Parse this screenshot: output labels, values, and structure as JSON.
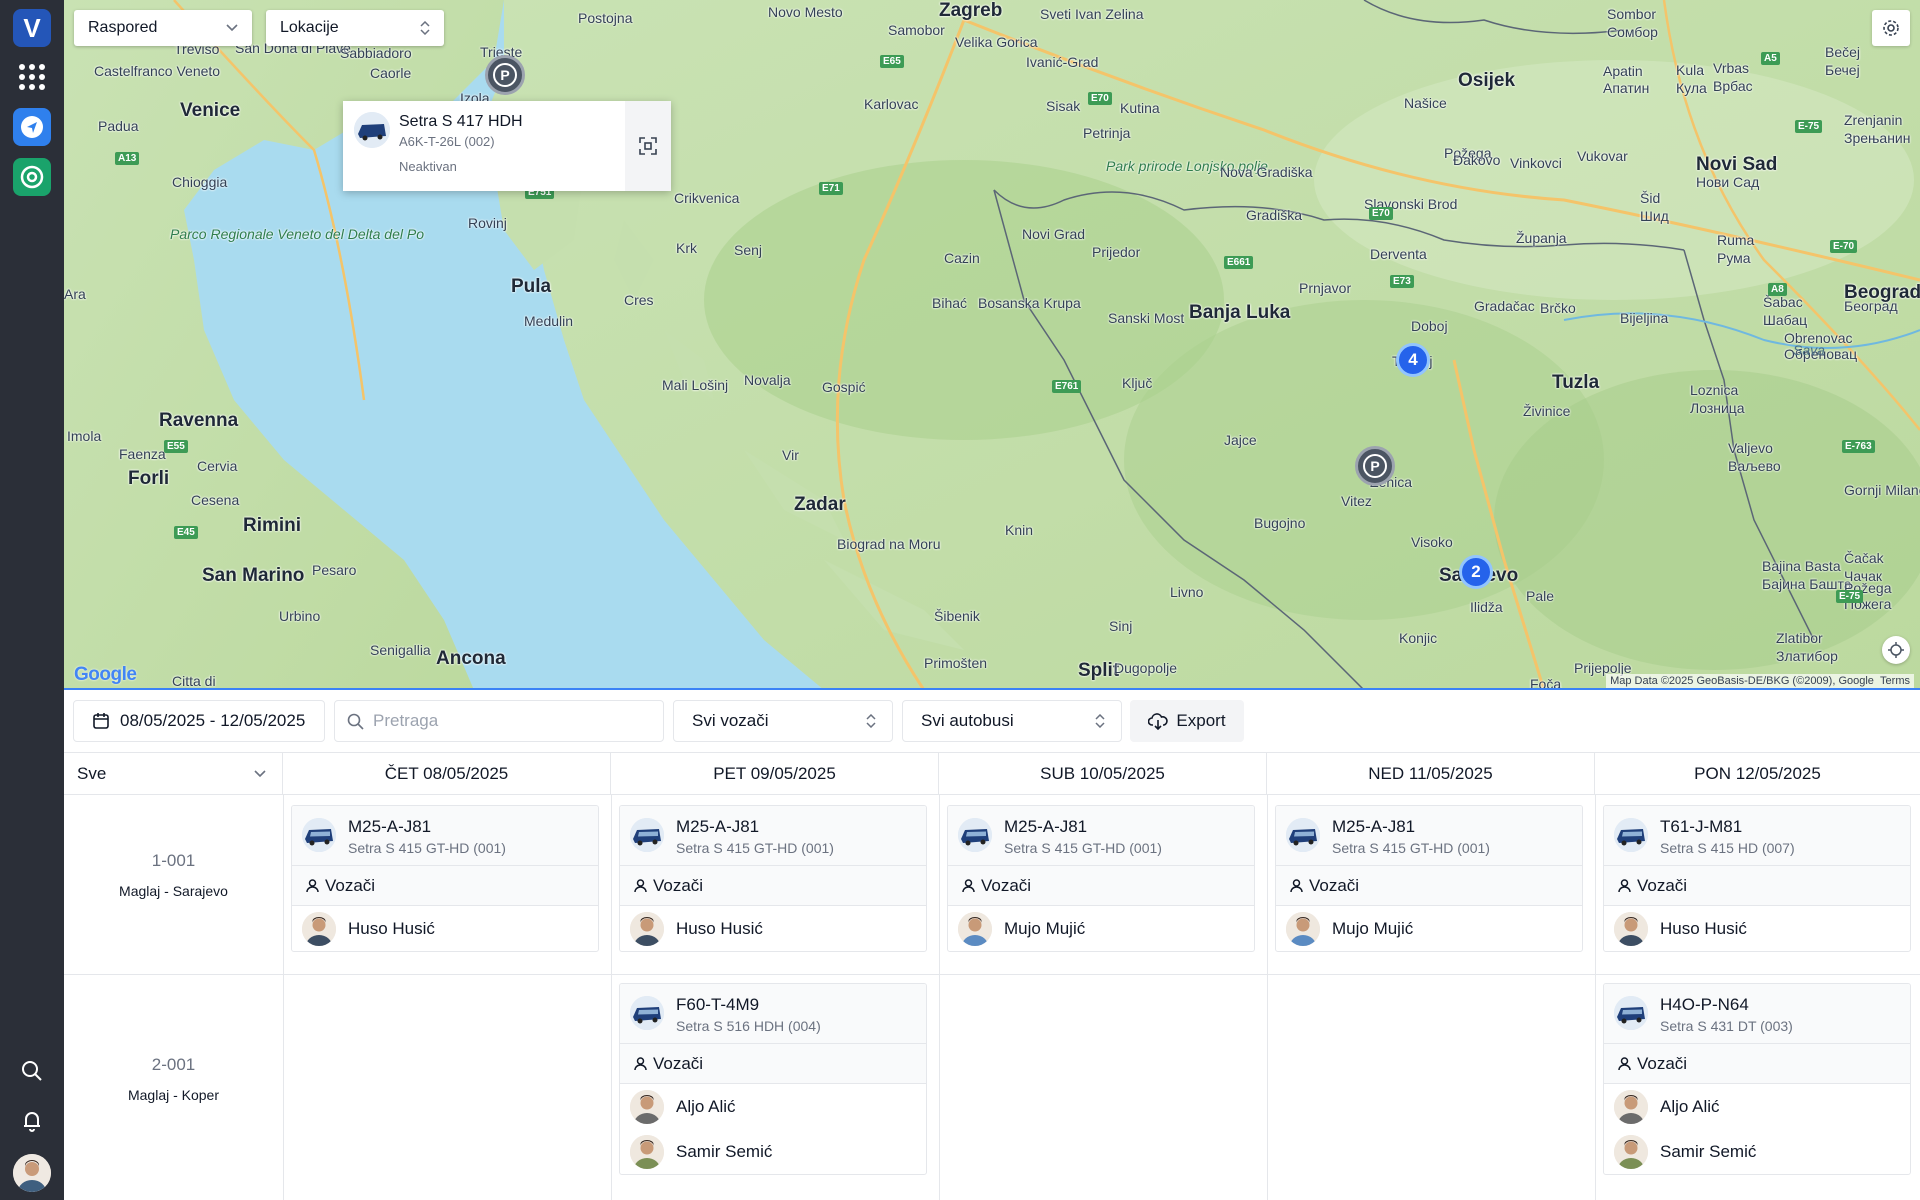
{
  "sidebar": {
    "logo_letter": "V",
    "icons": [
      "apps-grid-icon",
      "navigation-icon",
      "tracking-icon",
      "search-icon",
      "bell-icon"
    ]
  },
  "map": {
    "layer_select": "Raspored",
    "locations_select": "Lokacije",
    "popup": {
      "name": "Setra S 417 HDH",
      "plate": "A6K-T-26L (002)",
      "status": "Neaktivan"
    },
    "clusters": [
      "4",
      "2"
    ],
    "parking_symbol": "P",
    "attribution": "Map Data ©2025 GeoBasis-DE/BKG (©2009), Google",
    "terms": "Terms",
    "google": "Google",
    "labels": [
      {
        "t": "Venice",
        "c": "big"
      },
      {
        "t": "Trieste",
        "c": ""
      },
      {
        "t": "Padua",
        "c": ""
      },
      {
        "t": "Treviso",
        "c": ""
      },
      {
        "t": "Castelfranco Veneto",
        "c": ""
      },
      {
        "t": "San Dona di Piave",
        "c": ""
      },
      {
        "t": "Sabbiadoro",
        "c": ""
      },
      {
        "t": "Caorle",
        "c": ""
      },
      {
        "t": "Postojna",
        "c": ""
      },
      {
        "t": "Novo Mesto",
        "c": ""
      },
      {
        "t": "Zagreb",
        "c": "big"
      },
      {
        "t": "Samobor",
        "c": ""
      },
      {
        "t": "Velika Gorica",
        "c": ""
      },
      {
        "t": "Sveti Ivan Zelina",
        "c": ""
      },
      {
        "t": "Ivanić-Grad",
        "c": ""
      },
      {
        "t": "Karlovac",
        "c": ""
      },
      {
        "t": "Sisak",
        "c": ""
      },
      {
        "t": "Kutina",
        "c": ""
      },
      {
        "t": "Petrinja",
        "c": ""
      },
      {
        "t": "Park prirode Lonjsko polje",
        "c": "green"
      },
      {
        "t": "Našice",
        "c": ""
      },
      {
        "t": "Osijek",
        "c": "big"
      },
      {
        "t": "Požega",
        "c": ""
      },
      {
        "t": "Đakovo",
        "c": ""
      },
      {
        "t": "Vinkovci",
        "c": ""
      },
      {
        "t": "Vukovar",
        "c": ""
      },
      {
        "t": "Nova Gradiška",
        "c": ""
      },
      {
        "t": "Slavonski Brod",
        "c": ""
      },
      {
        "t": "Gradiška",
        "c": ""
      },
      {
        "t": "Novi Grad",
        "c": ""
      },
      {
        "t": "Prijedor",
        "c": ""
      },
      {
        "t": "Derventa",
        "c": ""
      },
      {
        "t": "Županja",
        "c": ""
      },
      {
        "t": "Cazin",
        "c": ""
      },
      {
        "t": "Bihać",
        "c": ""
      },
      {
        "t": "Bosanska Krupa",
        "c": ""
      },
      {
        "t": "Sanski Most",
        "c": ""
      },
      {
        "t": "Banja Luka",
        "c": "big"
      },
      {
        "t": "Prnjavor",
        "c": ""
      },
      {
        "t": "Doboj",
        "c": ""
      },
      {
        "t": "Gradačac",
        "c": ""
      },
      {
        "t": "Brčko",
        "c": ""
      },
      {
        "t": "Bijeljina",
        "c": ""
      },
      {
        "t": "Tuzla",
        "c": "big"
      },
      {
        "t": "Živinice",
        "c": ""
      },
      {
        "t": "Tešanj",
        "c": ""
      },
      {
        "t": "Ključ",
        "c": ""
      },
      {
        "t": "Jajce",
        "c": ""
      },
      {
        "t": "Vitez",
        "c": ""
      },
      {
        "t": "Zenica",
        "c": ""
      },
      {
        "t": "Bugojno",
        "c": ""
      },
      {
        "t": "Visoko",
        "c": ""
      },
      {
        "t": "Sarajevo",
        "c": "big"
      },
      {
        "t": "Pale",
        "c": ""
      },
      {
        "t": "Ilidža",
        "c": ""
      },
      {
        "t": "Konjic",
        "c": ""
      },
      {
        "t": "Livno",
        "c": ""
      },
      {
        "t": "Knin",
        "c": ""
      },
      {
        "t": "Sinj",
        "c": ""
      },
      {
        "t": "Split",
        "c": "big"
      },
      {
        "t": "Dugopolje",
        "c": ""
      },
      {
        "t": "Šibenik",
        "c": ""
      },
      {
        "t": "Primošten",
        "c": ""
      },
      {
        "t": "Zadar",
        "c": "big"
      },
      {
        "t": "Biograd na Moru",
        "c": ""
      },
      {
        "t": "Vir",
        "c": ""
      },
      {
        "t": "Gospić",
        "c": ""
      },
      {
        "t": "Novalja",
        "c": ""
      },
      {
        "t": "Mali Lošinj",
        "c": ""
      },
      {
        "t": "Cres",
        "c": ""
      },
      {
        "t": "Krk",
        "c": ""
      },
      {
        "t": "Senj",
        "c": ""
      },
      {
        "t": "Crikvenica",
        "c": ""
      },
      {
        "t": "Rovinj",
        "c": ""
      },
      {
        "t": "Pula",
        "c": "big"
      },
      {
        "t": "Medulin",
        "c": ""
      },
      {
        "t": "Chioggia",
        "c": ""
      },
      {
        "t": "Parco Regionale Veneto del Delta del Po",
        "c": "green"
      },
      {
        "t": "Ravenna",
        "c": "big"
      },
      {
        "t": "Faenza",
        "c": ""
      },
      {
        "t": "Forli",
        "c": "big"
      },
      {
        "t": "Cervia",
        "c": ""
      },
      {
        "t": "Cesena",
        "c": ""
      },
      {
        "t": "Rimini",
        "c": "big"
      },
      {
        "t": "San Marino",
        "c": "big"
      },
      {
        "t": "Pesaro",
        "c": ""
      },
      {
        "t": "Urbino",
        "c": ""
      },
      {
        "t": "Senigallia",
        "c": ""
      },
      {
        "t": "Ancona",
        "c": "big"
      },
      {
        "t": "Citta di",
        "c": ""
      },
      {
        "t": "Imola",
        "c": ""
      },
      {
        "t": "Novi Sad",
        "c": "big"
      },
      {
        "t": "Нови Сад",
        "c": ""
      },
      {
        "t": "Sombor",
        "c": ""
      },
      {
        "t": "Сомбор",
        "c": ""
      },
      {
        "t": "Vrbas",
        "c": ""
      },
      {
        "t": "Врбас",
        "c": ""
      },
      {
        "t": "Bečej",
        "c": ""
      },
      {
        "t": "Бечеј",
        "c": ""
      },
      {
        "t": "Zrenjanin",
        "c": ""
      },
      {
        "t": "Зрењанин",
        "c": ""
      },
      {
        "t": "Apatin",
        "c": ""
      },
      {
        "t": "Апатин",
        "c": ""
      },
      {
        "t": "Kula",
        "c": ""
      },
      {
        "t": "Кула",
        "c": ""
      },
      {
        "t": "Šid",
        "c": ""
      },
      {
        "t": "Шид",
        "c": ""
      },
      {
        "t": "Ruma",
        "c": ""
      },
      {
        "t": "Рума",
        "c": ""
      },
      {
        "t": "Šabac",
        "c": ""
      },
      {
        "t": "Шабац",
        "c": ""
      },
      {
        "t": "Obrenovac",
        "c": ""
      },
      {
        "t": "Обреновац",
        "c": ""
      },
      {
        "t": "Sava",
        "c": "sea"
      },
      {
        "t": "Beograd",
        "c": "big"
      },
      {
        "t": "Београд",
        "c": ""
      },
      {
        "t": "Loznica",
        "c": ""
      },
      {
        "t": "Лозница",
        "c": ""
      },
      {
        "t": "Valjevo",
        "c": ""
      },
      {
        "t": "Ваљево",
        "c": ""
      },
      {
        "t": "Bajina Basta",
        "c": ""
      },
      {
        "t": "Бајина Башта",
        "c": ""
      },
      {
        "t": "Čačak",
        "c": ""
      },
      {
        "t": "Чачак",
        "c": ""
      },
      {
        "t": "Gornji Milanovac",
        "c": ""
      },
      {
        "t": "Požega",
        "c": ""
      },
      {
        "t": "Пожега",
        "c": ""
      },
      {
        "t": "Zlatibor",
        "c": ""
      },
      {
        "t": "Златибор",
        "c": ""
      },
      {
        "t": "Foča",
        "c": ""
      },
      {
        "t": "Prijepolje",
        "c": ""
      },
      {
        "t": "Izola",
        "c": ""
      },
      {
        "t": "Ara",
        "c": ""
      }
    ],
    "roads": [
      "E65",
      "E70",
      "E71",
      "E661",
      "E73",
      "E761",
      "E751",
      "E55",
      "E45",
      "E70",
      "A5",
      "A13",
      "A8",
      "E-75",
      "E-70",
      "E-763",
      "E-75"
    ]
  },
  "toolbar": {
    "date_range": "08/05/2025 - 12/05/2025",
    "search_placeholder": "Pretraga",
    "drivers": "Svi vozači",
    "buses": "Svi autobusi",
    "export": "Export"
  },
  "grid": {
    "first_col": "Sve",
    "days": [
      "ČET 08/05/2025",
      "PET 09/05/2025",
      "SUB 10/05/2025",
      "NED 11/05/2025",
      "PON 12/05/2025"
    ],
    "drivers_label": "Vozači",
    "routes": [
      {
        "code": "1-001",
        "name": "Maglaj - Sarajevo",
        "cells": [
          {
            "plate": "M25-A-J81",
            "model": "Setra S 415 GT-HD (001)",
            "drivers": [
              "Huso Husić"
            ]
          },
          {
            "plate": "M25-A-J81",
            "model": "Setra S 415 GT-HD (001)",
            "drivers": [
              "Huso Husić"
            ]
          },
          {
            "plate": "M25-A-J81",
            "model": "Setra S 415 GT-HD (001)",
            "drivers": [
              "Mujo Mujić"
            ]
          },
          {
            "plate": "M25-A-J81",
            "model": "Setra S 415 GT-HD (001)",
            "drivers": [
              "Mujo Mujić"
            ]
          },
          {
            "plate": "T61-J-M81",
            "model": "Setra S 415 HD (007)",
            "drivers": [
              "Huso Husić"
            ]
          }
        ]
      },
      {
        "code": "2-001",
        "name": "Maglaj - Koper",
        "cells": [
          null,
          {
            "plate": "F60-T-4M9",
            "model": "Setra S 516 HDH (004)",
            "drivers": [
              "Aljo Alić",
              "Samir Semić"
            ]
          },
          null,
          null,
          {
            "plate": "H4O-P-N64",
            "model": "Setra S 431 DT (003)",
            "drivers": [
              "Aljo Alić",
              "Samir Semić"
            ]
          }
        ]
      }
    ]
  }
}
